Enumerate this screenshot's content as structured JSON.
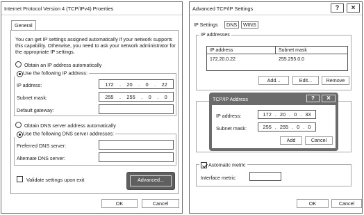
{
  "ipv4_dialog": {
    "title": "Internet Protocol  Version 4 (TCP/IPv4) Proerties",
    "tab_general": "General",
    "description": "You can get IP settings assigned automatically if your network supports this capability. Otherwise, you need to ask your network administrator for the appropriate IP settings.",
    "obtain_ip_auto": "Obtain an IP address automatically",
    "use_following_ip": "Use the following IP address:",
    "ip_address_label": "IP address:",
    "ip_address": [
      "172",
      "20",
      "0",
      "22"
    ],
    "subnet_label": "Subnet mask:",
    "subnet_mask": [
      "255",
      "255",
      "0",
      "0"
    ],
    "gateway_label": "Default gateway:",
    "gateway_value": "",
    "obtain_dns_auto": "Obtain DNS server address automatically",
    "use_following_dns": "Use the following DNS server addresses:",
    "preferred_dns_label": "Preferred DNS server:",
    "alternate_dns_label": "Alternate DNS server:",
    "validate_label": "Validate settings upon exit",
    "advanced_button": "Advanced...",
    "ok_button": "OK",
    "cancel_button": "Cancel",
    "ip_mode_selected": "manual",
    "dns_mode_selected": "manual",
    "validate_checked": false
  },
  "advanced_dialog": {
    "title": "Advanced TCP/IP Settings",
    "help_button": "?",
    "close_button": "×",
    "tabs": [
      "IP Settings",
      "DNS",
      "WINS"
    ],
    "ip_addresses_group": "IP addresses",
    "columns": [
      "IP address",
      "Subnet mask"
    ],
    "rows": [
      {
        "ip": "172.20.0.22",
        "mask": "255.255.0.0"
      }
    ],
    "add_button": "Add...",
    "edit_button": "Edit...",
    "remove_button": "Remove",
    "automatic_metric": "Automatic metric",
    "automatic_metric_checked": true,
    "interface_metric_label": "Interface metric:",
    "interface_metric_value": "",
    "ok_button": "OK",
    "cancel_button": "Cancel"
  },
  "tcpip_address_dialog": {
    "title": "TCP/IP Address",
    "help_button": "?",
    "close_button": "×",
    "ip_address_label": "IP address:",
    "ip_address": [
      "172",
      "20",
      "0",
      "33"
    ],
    "subnet_label": "Subnet mask:",
    "subnet_mask": [
      "255",
      "255",
      "0",
      "0"
    ],
    "add_button": "Add",
    "cancel_button": "Cancel"
  },
  "colors": {
    "highlight": "#5f5f5f",
    "border": "#9a9a9a"
  }
}
